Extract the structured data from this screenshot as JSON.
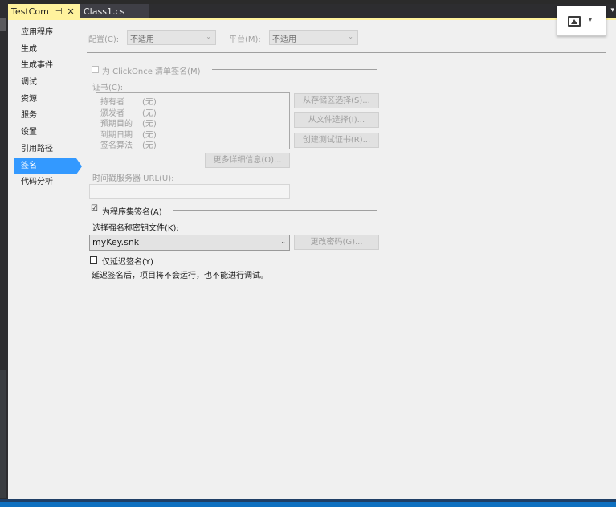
{
  "tabs": [
    {
      "label": "TestCom",
      "pin": "⊣",
      "close": "✕"
    },
    {
      "label": "Class1.cs"
    }
  ],
  "tab_overflow": "▾",
  "nav": {
    "items": [
      "应用程序",
      "生成",
      "生成事件",
      "调试",
      "资源",
      "服务",
      "设置",
      "引用路径",
      "签名",
      "代码分析"
    ],
    "selected": "签名"
  },
  "config": {
    "config_label": "配置(C):",
    "config_value": "不适用",
    "platform_label": "平台(M):",
    "platform_value": "不适用"
  },
  "clickonce": {
    "checkbox_label": "为 ClickOnce 清单签名(M)",
    "checked": false,
    "cert_label": "证书(C):",
    "cert_rows": [
      {
        "key": "持有者",
        "value": "(无)"
      },
      {
        "key": "颁发者",
        "value": "(无)"
      },
      {
        "key": "预期目的",
        "value": "(无)"
      },
      {
        "key": "到期日期",
        "value": "(无)"
      },
      {
        "key": "签名算法",
        "value": "(无)"
      }
    ],
    "from_store": "从存储区选择(S)...",
    "from_file": "从文件选择(I)...",
    "create_test": "创建测试证书(R)...",
    "more_details": "更多详细信息(O)...",
    "timestamp_label": "时间戳服务器 URL(U):",
    "timestamp_value": ""
  },
  "assembly": {
    "checkbox_label": "为程序集签名(A)",
    "checked": true,
    "check_mark": "☑",
    "key_label": "选择强名称密钥文件(K):",
    "key_value": "myKey.snk",
    "change_password": "更改密码(G)...",
    "delay_label": "仅延迟签名(Y)",
    "delay_checked": false,
    "note": "延迟签名后，项目将不会运行，也不能进行调试。"
  },
  "icons": {
    "image_button": "image-icon",
    "dropdown": "chevron-down-icon"
  },
  "colors": {
    "active_tab": "#fff29d",
    "selection": "#3399ff",
    "status_bar": "#0e70c0"
  }
}
